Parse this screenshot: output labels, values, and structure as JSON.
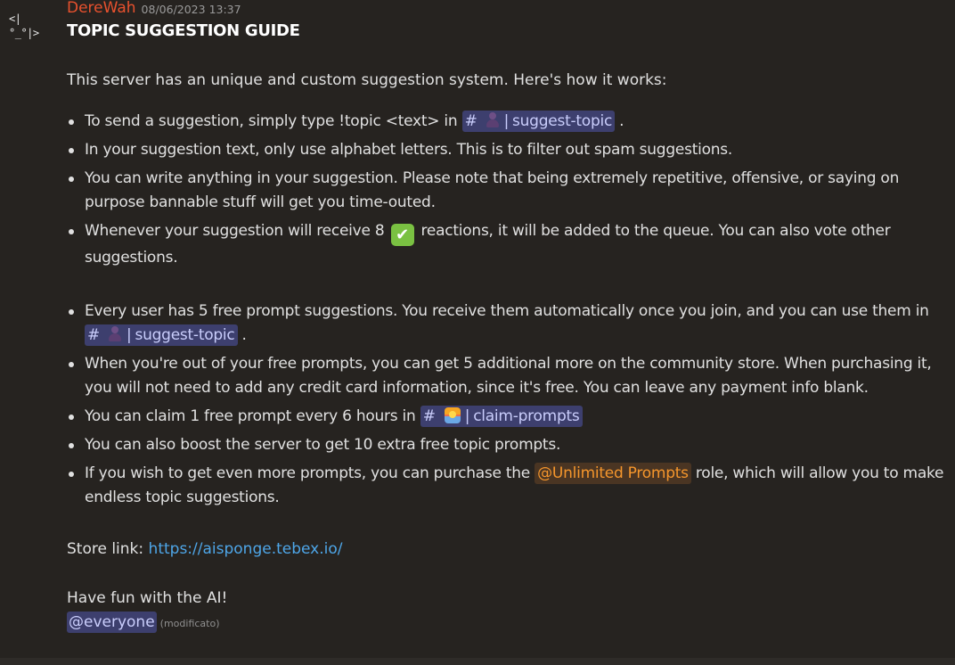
{
  "message": {
    "avatar_text": "<|°_°|>",
    "author": "DereWah",
    "timestamp": "08/06/2023 13:37",
    "title": "TOPIC SUGGESTION GUIDE",
    "intro": "This server has an unique and custom suggestion system. Here's how it works:",
    "rules_a": [
      {
        "before": "To send a suggestion, simply type !topic <text> in",
        "channel": "suggest-topic",
        "after": "."
      },
      {
        "text": "In your suggestion text, only use alphabet letters. This is to filter out spam suggestions."
      },
      {
        "text": "You can write anything in your suggestion. Please note that being extremely repetitive, offensive, or saying on purpose bannable stuff will get you time-outed."
      },
      {
        "before": "Whenever your suggestion will receive 8",
        "emoji": "✔",
        "after": "reactions, it will be added to the queue. You can also vote other suggestions."
      }
    ],
    "rules_b": [
      {
        "before": "Every user has 5 free prompt suggestions. You receive them automatically once you join, and you can use them in",
        "channel": "suggest-topic",
        "after": "."
      },
      {
        "text": "When you're out of your free prompts, you can get 5 additional more on the community store. When purchasing it, you will not need to add any credit card information, since it's free. You can leave any payment info blank."
      },
      {
        "before": "You can claim 1 free prompt every 6 hours in",
        "channel": "claim-prompts"
      },
      {
        "text": "You can also boost the server to get 10 extra free topic prompts."
      },
      {
        "before": "If you wish to get even more prompts, you can purchase the",
        "role": "@Unlimited Prompts",
        "after": "role, which will allow you to make endless topic suggestions."
      }
    ],
    "store_label": "Store link:",
    "store_url": "https://aisponge.tebex.io/",
    "closing": "Have fun with the AI!",
    "mention": "@everyone",
    "edited": "(modificato)",
    "channel_hash": "#",
    "channel_separator": "|"
  },
  "colors": {
    "background": "#262320",
    "author": "#e8512e",
    "channel_bg": "#3d3f6e",
    "channel_text": "#c9cdfb",
    "role_text": "#f5962c",
    "link": "#4ea6e8",
    "check_green": "#7ac142"
  }
}
